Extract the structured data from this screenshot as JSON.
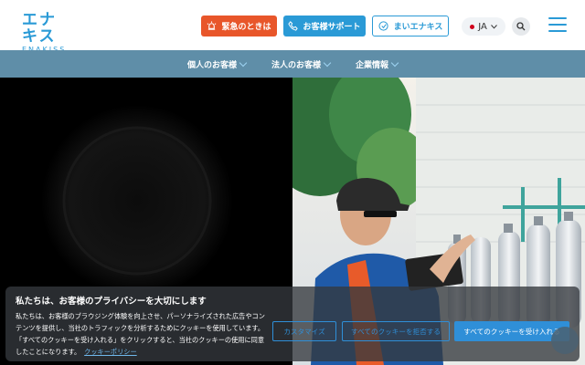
{
  "logo": {
    "main": "エナキス",
    "sub": "ENAKISS"
  },
  "header": {
    "emergency_label": "緊急のときは",
    "support_label": "お客様サポート",
    "my_label": "まいエナキス",
    "language": "JA"
  },
  "nav": [
    {
      "label": "個人のお客様"
    },
    {
      "label": "法人のお客様"
    },
    {
      "label": "企業情報"
    }
  ],
  "cookie": {
    "title": "私たちは、お客様のプライバシーを大切にします",
    "text": "私たちは、お客様のブラウジング体験を向上させ、パーソナライズされた広告やコンテンツを提供し、当社のトラフィックを分析するためにクッキーを使用しています。「すべてのクッキーを受け入れる」をクリックすると、当社のクッキーの使用に同意したことになります。",
    "policy_link": "クッキーポリシー",
    "customize_label": "カスタマイズ",
    "reject_label": "すべてのクッキーを拒否する",
    "accept_label": "すべてのクッキーを受け入れる"
  },
  "colors": {
    "brand": "#2a9ad6",
    "emergency": "#e8562a",
    "nav_bg": "#5f8ea8",
    "cookie_button": "#2f8fd8"
  }
}
